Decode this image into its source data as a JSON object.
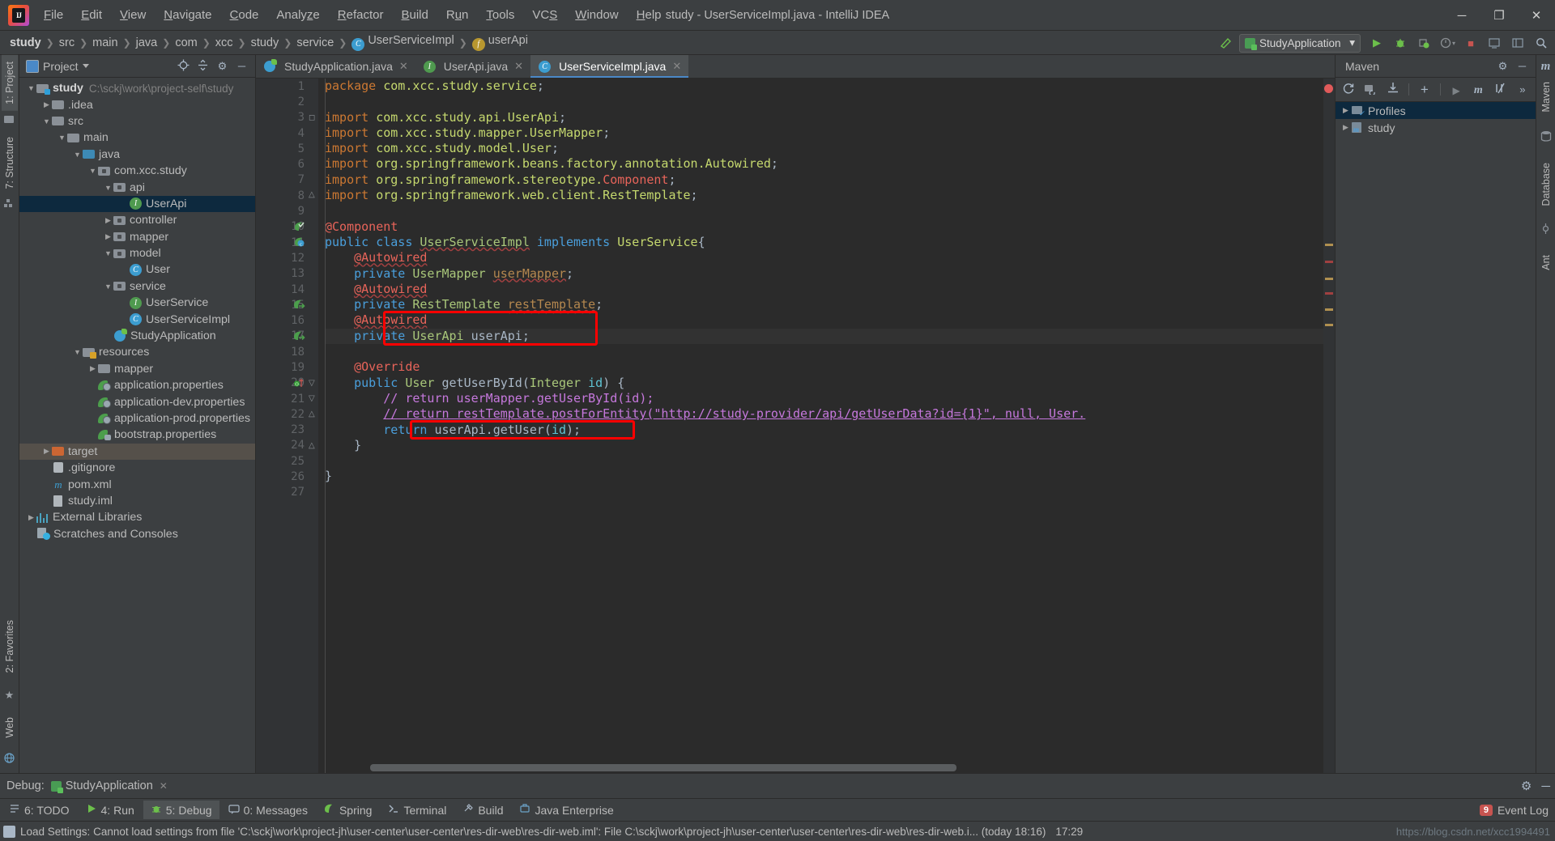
{
  "titlebar": {
    "window_title": "study - UserServiceImpl.java - IntelliJ IDEA",
    "menus": [
      "File",
      "Edit",
      "View",
      "Navigate",
      "Code",
      "Analyze",
      "Refactor",
      "Build",
      "Run",
      "Tools",
      "VCS",
      "Window",
      "Help"
    ],
    "minimize": "─",
    "maximize": "❐",
    "close": "✕",
    "logo_text": "IJ"
  },
  "breadcrumb": {
    "items": [
      "study",
      "src",
      "main",
      "java",
      "com",
      "xcc",
      "study",
      "service",
      "UserServiceImpl",
      "userApi"
    ],
    "class_icon": "C",
    "field_icon": "f",
    "separator": "❯"
  },
  "run_config": {
    "name": "StudyApplication",
    "dropdown_caret": "▾",
    "run_icon": "▶",
    "debug_icon": "debug-icon",
    "coverage_icon": "coverage-icon",
    "profiler_icon": "profiler-icon",
    "stop_icon": "■",
    "search_icon": "⚲"
  },
  "left_rail": {
    "tabs": [
      "1: Project",
      "7: Structure"
    ],
    "bottom_tabs": [
      "2: Favorites",
      "Web"
    ]
  },
  "project_panel": {
    "title": "Project",
    "caret": "▾",
    "locate_icon": "⊕",
    "collapse_icon": "≡",
    "settings_icon": "⚙",
    "hide_icon": "─",
    "tree": [
      {
        "depth": 0,
        "arrow": "▼",
        "icon": "folder-module",
        "label": "study",
        "bold": true,
        "path": "C:\\sckj\\work\\project-self\\study",
        "state": "normal"
      },
      {
        "depth": 1,
        "arrow": "▶",
        "icon": "folder",
        "label": ".idea",
        "state": "normal"
      },
      {
        "depth": 1,
        "arrow": "▼",
        "icon": "folder",
        "label": "src",
        "state": "normal"
      },
      {
        "depth": 2,
        "arrow": "▼",
        "icon": "folder",
        "label": "main",
        "state": "normal"
      },
      {
        "depth": 3,
        "arrow": "▼",
        "icon": "folder-source",
        "label": "java",
        "state": "normal"
      },
      {
        "depth": 4,
        "arrow": "▼",
        "icon": "folder-package",
        "label": "com.xcc.study",
        "state": "normal"
      },
      {
        "depth": 5,
        "arrow": "▼",
        "icon": "folder-package",
        "label": "api",
        "state": "normal"
      },
      {
        "depth": 6,
        "arrow": "",
        "icon": "interface",
        "label": "UserApi",
        "state": "selected"
      },
      {
        "depth": 5,
        "arrow": "▶",
        "icon": "folder-package",
        "label": "controller",
        "state": "normal"
      },
      {
        "depth": 5,
        "arrow": "▶",
        "icon": "folder-package",
        "label": "mapper",
        "state": "normal"
      },
      {
        "depth": 5,
        "arrow": "▼",
        "icon": "folder-package",
        "label": "model",
        "state": "normal"
      },
      {
        "depth": 6,
        "arrow": "",
        "icon": "class",
        "label": "User",
        "state": "normal"
      },
      {
        "depth": 5,
        "arrow": "▼",
        "icon": "folder-package",
        "label": "service",
        "state": "normal"
      },
      {
        "depth": 6,
        "arrow": "",
        "icon": "interface",
        "label": "UserService",
        "state": "normal"
      },
      {
        "depth": 6,
        "arrow": "",
        "icon": "class",
        "label": "UserServiceImpl",
        "state": "normal"
      },
      {
        "depth": 5,
        "arrow": "",
        "icon": "spring-class",
        "label": "StudyApplication",
        "state": "normal"
      },
      {
        "depth": 3,
        "arrow": "▼",
        "icon": "folder-resources",
        "label": "resources",
        "state": "normal"
      },
      {
        "depth": 4,
        "arrow": "▶",
        "icon": "folder",
        "label": "mapper",
        "state": "normal"
      },
      {
        "depth": 4,
        "arrow": "",
        "icon": "properties",
        "label": "application.properties",
        "state": "normal"
      },
      {
        "depth": 4,
        "arrow": "",
        "icon": "properties",
        "label": "application-dev.properties",
        "state": "normal"
      },
      {
        "depth": 4,
        "arrow": "",
        "icon": "properties",
        "label": "application-prod.properties",
        "state": "normal"
      },
      {
        "depth": 4,
        "arrow": "",
        "icon": "properties-plain",
        "label": "bootstrap.properties",
        "state": "normal"
      },
      {
        "depth": 1,
        "arrow": "▶",
        "icon": "folder-target",
        "label": "target",
        "state": "highlight"
      },
      {
        "depth": 1,
        "arrow": "",
        "icon": "git",
        "label": ".gitignore",
        "state": "normal"
      },
      {
        "depth": 1,
        "arrow": "",
        "icon": "maven",
        "label": "pom.xml",
        "state": "normal"
      },
      {
        "depth": 1,
        "arrow": "",
        "icon": "xml",
        "label": "study.iml",
        "state": "normal"
      },
      {
        "depth": 0,
        "arrow": "▶",
        "icon": "libraries",
        "label": "External Libraries",
        "state": "normal"
      },
      {
        "depth": 0,
        "arrow": "",
        "icon": "scratches",
        "label": "Scratches and Consoles",
        "state": "normal"
      }
    ]
  },
  "editor": {
    "tabs": [
      {
        "label": "StudyApplication.java",
        "icon": "spring-class-icon",
        "active": false,
        "close": "✕"
      },
      {
        "label": "UserApi.java",
        "icon": "interface-icon",
        "active": false,
        "close": "✕"
      },
      {
        "label": "UserServiceImpl.java",
        "icon": "class-icon",
        "active": true,
        "close": "✕"
      }
    ],
    "first_line": 1,
    "total_lines": 27,
    "current_line": 17,
    "lines": [
      {
        "n": 1,
        "html": "<span class=\"kw\">package</span> <span class=\"pkgn\">com.xcc.study.service</span><span class=\"plain\">;</span>"
      },
      {
        "n": 2,
        "html": ""
      },
      {
        "n": 3,
        "html": "<span class=\"kw\">import</span> <span class=\"pkgn\">com.xcc.study.api.UserApi</span><span class=\"plain\">;</span>"
      },
      {
        "n": 4,
        "html": "<span class=\"kw\">import</span> <span class=\"pkgn\">com.xcc.study.mapper.UserMapper</span><span class=\"plain\">;</span>"
      },
      {
        "n": 5,
        "html": "<span class=\"kw\">import</span> <span class=\"pkgn\">com.xcc.study.model.User</span><span class=\"plain\">;</span>"
      },
      {
        "n": 6,
        "html": "<span class=\"kw\">import</span> <span class=\"pkgn\">org.springframework.beans.factory.annotation.Autowired</span><span class=\"plain\">;</span>"
      },
      {
        "n": 7,
        "html": "<span class=\"kw\">import</span> <span class=\"pkgn\">org.springframework.stereotype.</span><span class=\"annred\">Component</span><span class=\"plain\">;</span>"
      },
      {
        "n": 8,
        "html": "<span class=\"kw\">import</span> <span class=\"pkgn\">org.springframework.web.client.RestTemplate</span><span class=\"plain\">;</span>"
      },
      {
        "n": 9,
        "html": ""
      },
      {
        "n": 10,
        "html": "<span class=\"annred\">@Component</span>"
      },
      {
        "n": 11,
        "html": "<span class=\"kw2\">public</span> <span class=\"kw2\">class</span> <span class=\"cls wavy\">UserServiceImpl</span> <span class=\"kw2\">implements</span> <span class=\"pkgn\">UserService</span><span class=\"plain\">{</span>"
      },
      {
        "n": 12,
        "html": "    <span class=\"annred wavy\">@Autowired</span>"
      },
      {
        "n": 13,
        "html": "    <span class=\"kw2\">private</span> <span class=\"cls\">UserMapper</span> <span class=\"fldb wavy\">userMapper</span><span class=\"plain\">;</span>"
      },
      {
        "n": 14,
        "html": "    <span class=\"annred wavy\">@Autowired</span>"
      },
      {
        "n": 15,
        "html": "    <span class=\"kw2\">private</span> <span class=\"cls\">RestTemplate</span> <span class=\"fldb wavy\">restTemplate</span><span class=\"plain\">;</span>"
      },
      {
        "n": 16,
        "html": "    <span class=\"annred wavy\">@Autowired</span>"
      },
      {
        "n": 17,
        "html": "    <span class=\"kw2\">private</span> <span class=\"cls\">UserApi</span> <span class=\"plain\">userApi;</span>"
      },
      {
        "n": 18,
        "html": ""
      },
      {
        "n": 19,
        "html": "    <span class=\"annred\">@Override</span>"
      },
      {
        "n": 20,
        "html": "    <span class=\"kw2\">public</span> <span class=\"cls\">User</span> <span class=\"plain\">getUserById(</span><span class=\"cls\">Integer</span> <span class=\"typ\">id</span><span class=\"plain\">) {</span>"
      },
      {
        "n": 21,
        "html": "        <span class=\"cmt2\">// return userMapper.getUserById(id);</span>"
      },
      {
        "n": 22,
        "html": "        <span class=\"cmt2 ul\">// return restTemplate.postForEntity(\"http://study-provider/api/getUserData?id={1}\", null, User.</span>"
      },
      {
        "n": 23,
        "html": "        <span class=\"kw2\">return</span> <span class=\"plain\">userApi.getUser(</span><span class=\"typ\">id</span><span class=\"plain\">);</span>"
      },
      {
        "n": 24,
        "html": "    <span class=\"plain\">}</span>"
      },
      {
        "n": 25,
        "html": ""
      },
      {
        "n": 26,
        "html": "<span class=\"plain\">}</span>"
      },
      {
        "n": 27,
        "html": ""
      }
    ],
    "annotation_boxes": [
      {
        "name": "autowired-userapi-highlight",
        "line_start": 16,
        "line_end": 17
      },
      {
        "name": "return-userapi-highlight",
        "line_start": 23,
        "line_end": 23
      }
    ]
  },
  "maven_panel": {
    "title": "Maven",
    "settings_icon": "⚙",
    "hide_icon": "─",
    "toolbar_icons": [
      "reimport-icon",
      "generate-sources-icon",
      "download-sources-icon",
      "add-icon",
      "run-icon",
      "execute-goal-icon",
      "toggle-skip-tests-icon",
      "more-icon"
    ],
    "rows": [
      {
        "label": "Profiles",
        "arrow": "▶",
        "icon": "profiles-icon",
        "selected": true
      },
      {
        "label": "study",
        "arrow": "▶",
        "icon": "maven-module-icon",
        "selected": false
      }
    ]
  },
  "right_rail": {
    "tabs": [
      "Maven",
      "Database",
      "Ant"
    ]
  },
  "debug_bar": {
    "label": "Debug:",
    "config_name": "StudyApplication",
    "close": "✕",
    "settings_icon": "⚙",
    "hide_icon": "─"
  },
  "tool_window_bar": {
    "items": [
      {
        "label": "6: TODO",
        "icon": "todo-icon",
        "active": false
      },
      {
        "label": "4: Run",
        "icon": "run-icon",
        "active": false
      },
      {
        "label": "5: Debug",
        "icon": "debug-icon",
        "active": true
      },
      {
        "label": "0: Messages",
        "icon": "messages-icon",
        "active": false
      },
      {
        "label": "Spring",
        "icon": "spring-icon",
        "active": false
      },
      {
        "label": "Terminal",
        "icon": "terminal-icon",
        "active": false
      },
      {
        "label": "Build",
        "icon": "build-icon",
        "active": false
      },
      {
        "label": "Java Enterprise",
        "icon": "java-enterprise-icon",
        "active": false
      }
    ],
    "event_log": {
      "label": "Event Log",
      "count": "9"
    }
  },
  "status_bar": {
    "message": "Load Settings: Cannot load settings from file 'C:\\sckj\\work\\project-jh\\user-center\\user-center\\res-dir-web\\res-dir-web.iml': File C:\\sckj\\work\\project-jh\\user-center\\user-center\\res-dir-web\\res-dir-web.i... (today 18:16)",
    "time": "17:29",
    "watermark": "https://blog.csdn.net/xcc1994491"
  },
  "colors": {
    "accent": "#4a88c7",
    "annotation_box": "#ff0000",
    "selection": "#0d293e",
    "editor_bg": "#2b2b2b",
    "panel_bg": "#3c3f41"
  }
}
